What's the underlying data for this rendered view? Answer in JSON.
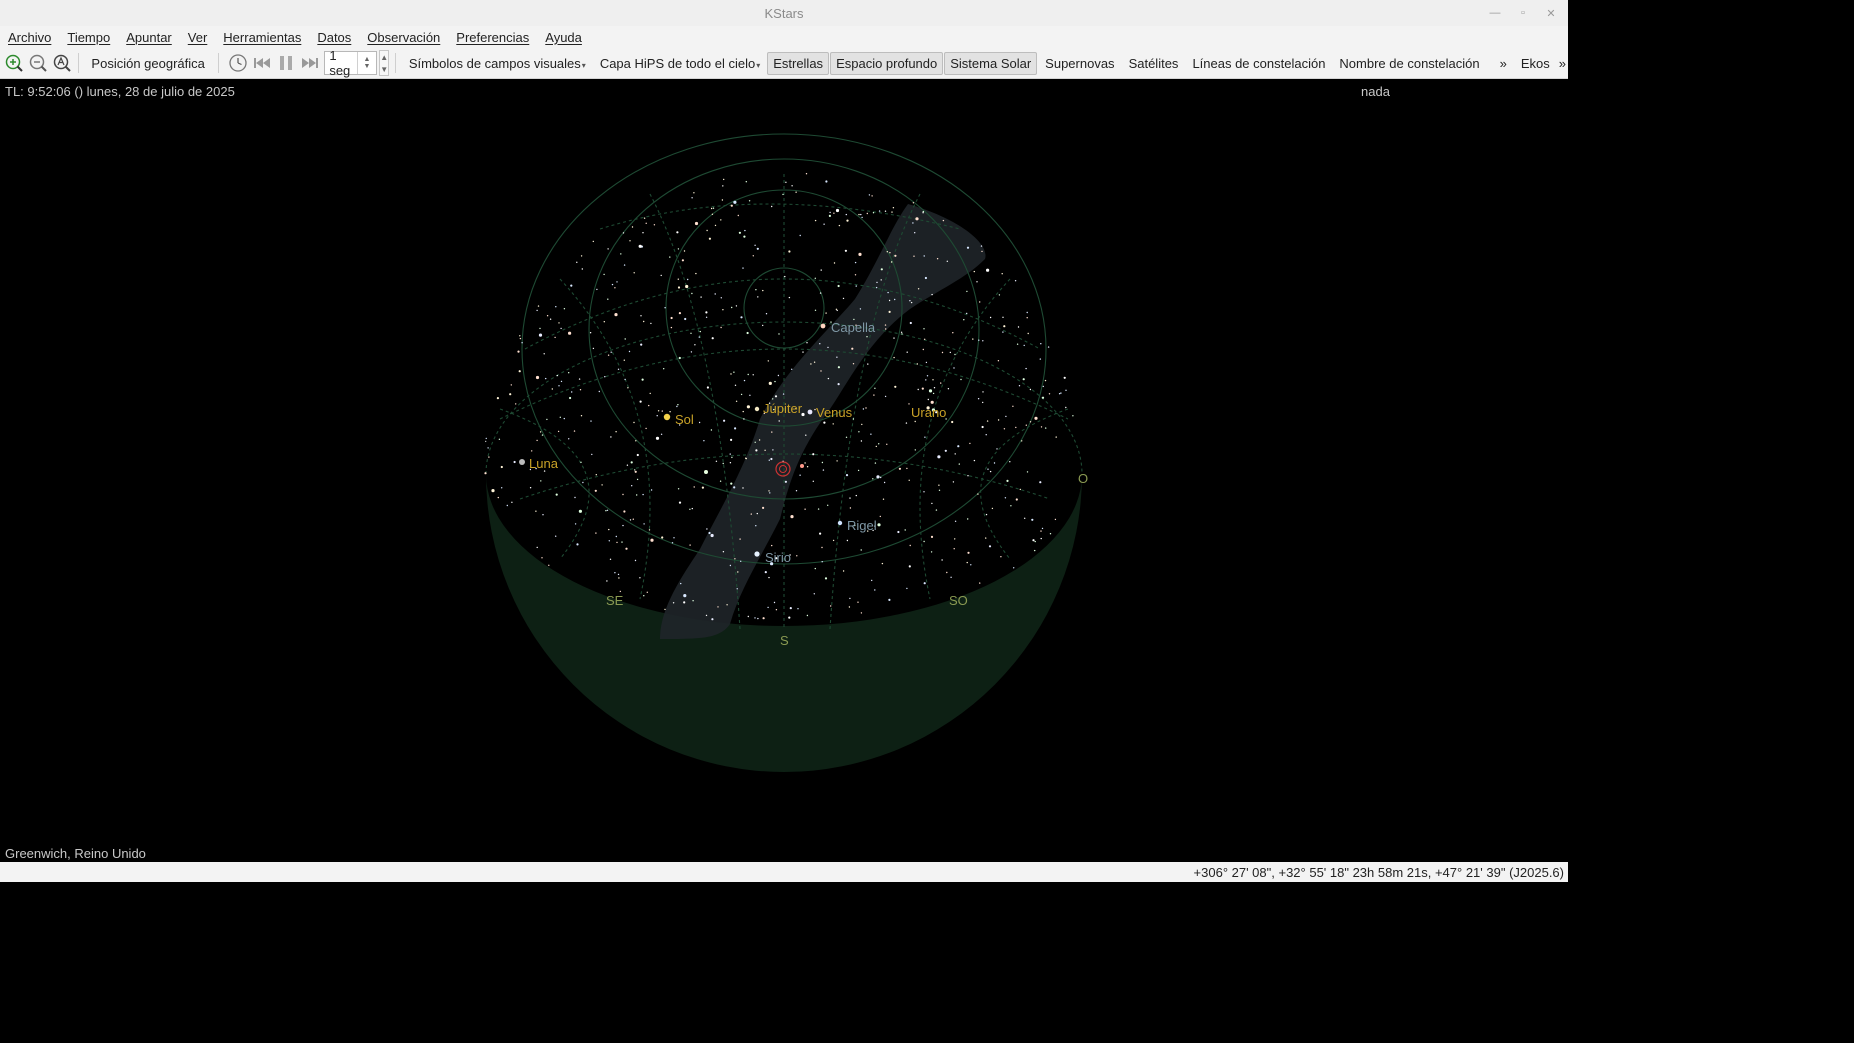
{
  "window": {
    "title": "KStars"
  },
  "menu": [
    "Archivo",
    "Tiempo",
    "Apuntar",
    "Ver",
    "Herramientas",
    "Datos",
    "Observación",
    "Preferencias",
    "Ayuda"
  ],
  "toolbar": {
    "geo_position": "Posición geográfica",
    "time_step": "1 seg",
    "fov_symbols": "Símbolos de campos visuales",
    "hips_layer": "Capa HiPS de todo el cielo",
    "stars": "Estrellas",
    "deep_sky": "Espacio profundo",
    "solar_system": "Sistema Solar",
    "supernovae": "Supernovas",
    "satellites": "Satélites",
    "constellation_lines": "Líneas de constelación",
    "constellation_names": "Nombre de constelación",
    "more": "»",
    "ekos": "Ekos",
    "more2": "»"
  },
  "skymap": {
    "time_info": "TL: 9:52:06 ()  lunes, 28 de julio de 2025",
    "focus_object": "nada",
    "location": "Greenwich, Reino Unido",
    "labels": {
      "capella": "Capella",
      "jupiter": "Júpiter",
      "venus": "Venus",
      "urano": "Urano",
      "sol": "Sol",
      "luna": "Luna",
      "rigel": "Rigel",
      "sirio": "Sirio"
    },
    "compass": {
      "se": "SE",
      "so": "SO",
      "s": "S",
      "o": "O"
    }
  },
  "status": {
    "coords": "+306° 27' 08\", +32° 55' 18\"  23h 58m 21s, +47° 21' 39\" (J2025.6)"
  },
  "colors": {
    "ground": "#0d2014",
    "grid": "#1e4a33",
    "milky_way": "#2a3035",
    "planet_label": "#c9a227",
    "star_label": "#7f98a6",
    "compass": "#8a9a52"
  },
  "icons": [
    "zoom-in-icon",
    "zoom-out-icon",
    "zoom-default-icon",
    "clock-icon",
    "skip-back-icon",
    "pause-icon",
    "skip-forward-icon"
  ]
}
